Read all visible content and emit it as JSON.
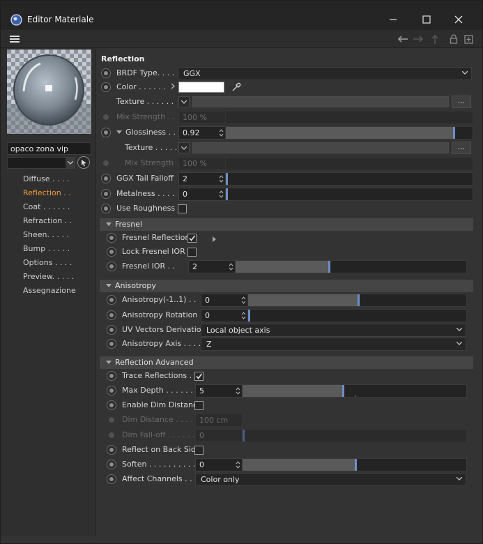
{
  "window": {
    "title": "Editor Materiale",
    "background_color": "#333333",
    "accent_color": "#6e8fc7",
    "active_nav_color": "#f09a3e"
  },
  "material": {
    "name": "opaco zona vip"
  },
  "nav": [
    {
      "label": "Diffuse . . . ."
    },
    {
      "label": "Reflection . .",
      "active": true
    },
    {
      "label": "Coat . . . . . ."
    },
    {
      "label": "Refraction . ."
    },
    {
      "label": "Sheen. . . . ."
    },
    {
      "label": "Bump . . . . ."
    },
    {
      "label": "Options . . . ."
    },
    {
      "label": "Preview. . . . ."
    },
    {
      "label": "Assegnazione"
    }
  ],
  "reflection": {
    "heading": "Reflection",
    "brdf_label": "BRDF Type. . . . .",
    "brdf_value": "GGX",
    "color_label": "Color . . . . . .",
    "color_value": "#ffffff",
    "texture_label": "Texture . . . . . .",
    "texture_button": "...",
    "mix_label": "Mix Strength . . .",
    "mix_value": "100 %",
    "glossiness_label": "Glossiness . . .",
    "glossiness_value": "0.92",
    "glossiness_fraction": 0.92,
    "gloss_texture_label": "Texture . . . . .",
    "gloss_texture_button": "...",
    "gloss_mix_label": "Mix Strength",
    "gloss_mix_value": "100 %",
    "ggx_label": "GGX Tail Falloff",
    "ggx_value": "2",
    "metalness_label": "Metalness . . . .",
    "metalness_value": "0",
    "use_roughness_label": "Use Roughness",
    "use_roughness_checked": false
  },
  "fresnel": {
    "title": "Fresnel",
    "reflections_label": "Fresnel Reflections",
    "reflections_checked": true,
    "lock_label": "Lock Fresnel IOR",
    "lock_checked": false,
    "ior_label": "Fresnel IOR . .",
    "ior_value": "2"
  },
  "anisotropy": {
    "title": "Anisotropy",
    "aniso_label": "Anisotropy(-1..1) . .",
    "aniso_value": "0",
    "rotation_label": "Anisotropy Rotation",
    "rotation_value": "0",
    "uv_label": "UV Vectors Derivation",
    "uv_value": "Local object axis",
    "axis_label": "Anisotropy Axis . . . .",
    "axis_value": "Z"
  },
  "advanced": {
    "title": "Reflection Advanced",
    "trace_label": "Trace Reflections . .",
    "trace_checked": true,
    "maxdepth_label": "Max Depth . . . . . .",
    "maxdepth_value": "5",
    "enable_dim_label": "Enable Dim Distance",
    "enable_dim_checked": false,
    "dimdist_label": "Dim Distance . . . . .",
    "dimdist_value": "100 cm",
    "dimfall_label": "Dim Fall-off . . . . . .",
    "dimfall_value": "0",
    "backside_label": "Reflect on Back Side",
    "backside_checked": false,
    "soften_label": "Soften . . . . . . . . . .",
    "soften_value": "0",
    "affect_label": "Affect Channels . . .",
    "affect_value": "Color only"
  }
}
